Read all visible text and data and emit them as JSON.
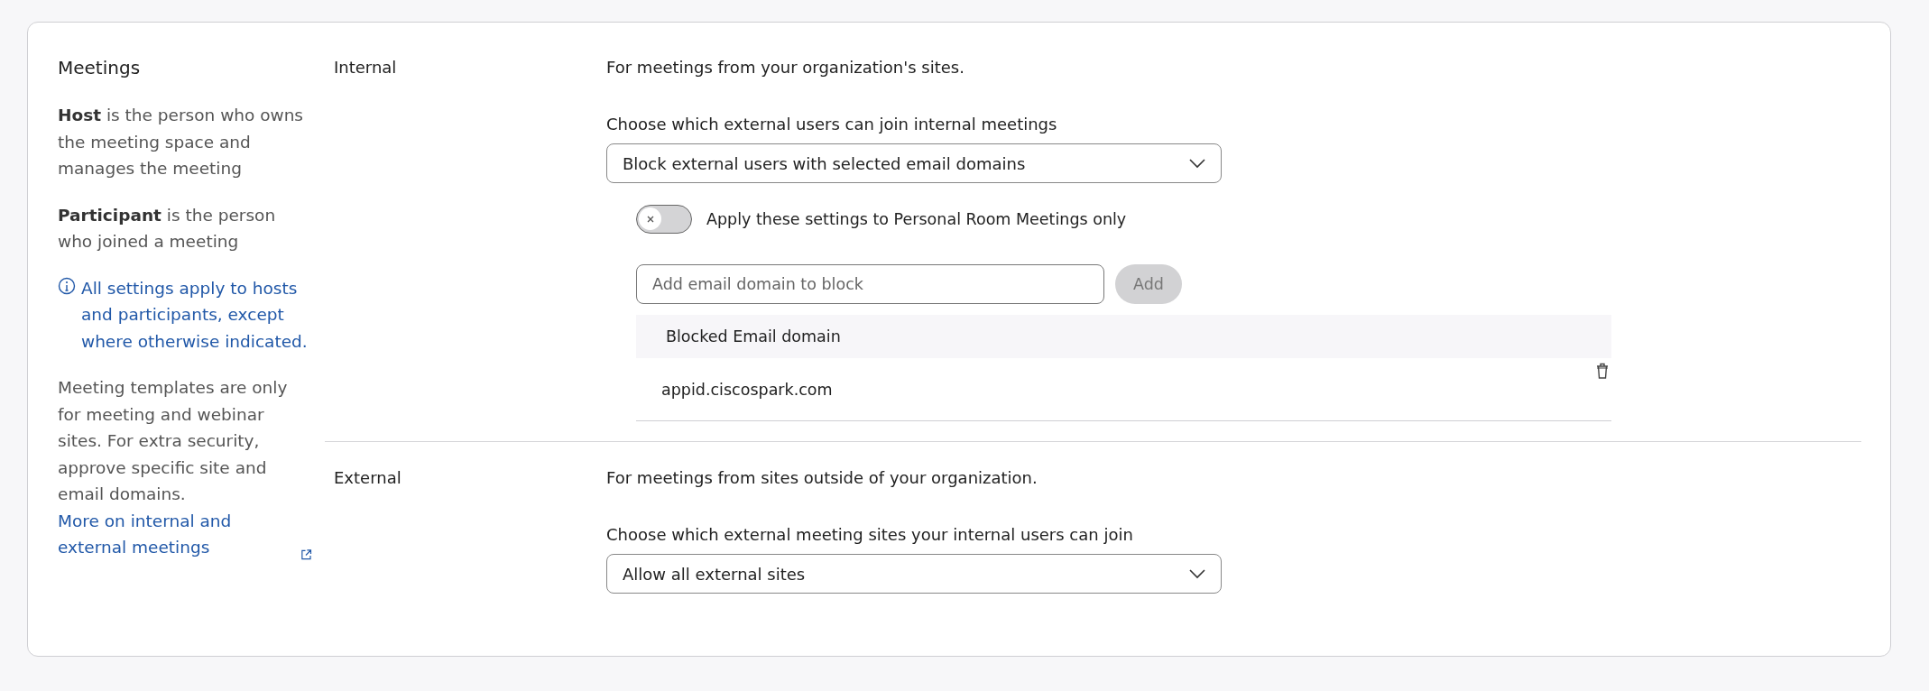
{
  "sidebar": {
    "title": "Meetings",
    "paragraphs": [
      "**Host** is the person who owns the meeting space and manages the meeting",
      "**Participant** is the person who joined a meeting"
    ],
    "info": "All settings apply to hosts and participants, except where otherwise indicated.",
    "note": "Meeting templates are only for meeting and webinar sites. For extra security, approve specific site and email domains.",
    "note_link": "More on internal and external meetings"
  },
  "sections": [
    {
      "label": "Internal",
      "description": "For meetings from your organization's sites.",
      "prompt": "Choose which external users can join internal meetings",
      "dropdown": {
        "value": "Block external users with selected email domains"
      },
      "toggle": {
        "on": false,
        "label": "Apply these settings to Personal Room Meetings only"
      },
      "domain_input": {
        "placeholder": "Add email domain to block"
      },
      "add_button": {
        "label": "Add",
        "disabled": true
      },
      "table": {
        "columns": [
          "Blocked Email domain"
        ],
        "rows": [
          [
            "appid.ciscospark.com"
          ]
        ]
      }
    },
    {
      "label": "External",
      "description": "For meetings from sites outside of your organization.",
      "prompt": "Choose which external meeting sites your internal users can join",
      "dropdown": {
        "value": "Allow all external sites"
      }
    }
  ]
}
